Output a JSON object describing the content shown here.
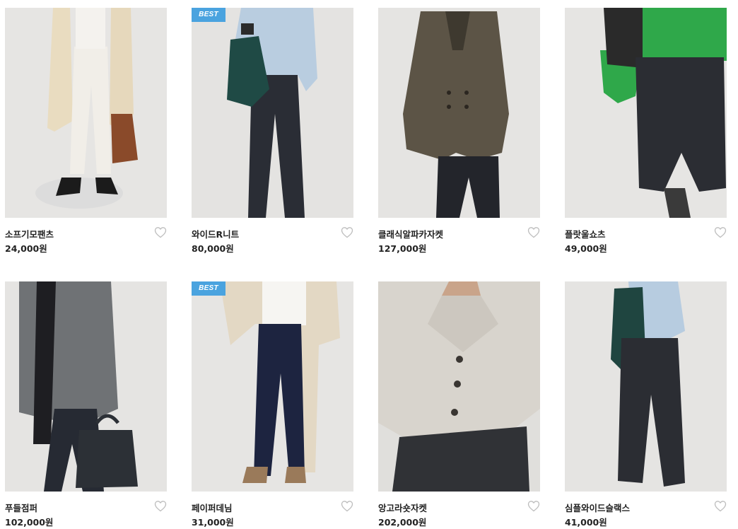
{
  "products": [
    {
      "name": "소프기모팬츠",
      "price": "24,000원",
      "badge": "",
      "image": "photo-beige-coat-white-pants-brown-bag"
    },
    {
      "name": "와이드R니트",
      "price": "80,000원",
      "badge": "BEST",
      "image": "photo-light-blue-knit-dark-scarf"
    },
    {
      "name": "클래식알파카자켓",
      "price": "127,000원",
      "badge": "",
      "image": "photo-brown-double-breasted-jacket"
    },
    {
      "name": "플랏울쇼츠",
      "price": "49,000원",
      "badge": "",
      "image": "photo-green-sweater-charcoal-shorts"
    },
    {
      "name": "푸들점퍼",
      "price": "102,000원",
      "badge": "",
      "image": "photo-gray-boucle-jumper-black-bag"
    },
    {
      "name": "페이퍼데님",
      "price": "31,000원",
      "badge": "BEST",
      "image": "photo-cream-coat-dark-denim"
    },
    {
      "name": "앙고라숏자켓",
      "price": "202,000원",
      "badge": "",
      "image": "photo-light-gray-angora-short-jacket"
    },
    {
      "name": "심플와이드슬랙스",
      "price": "41,000원",
      "badge": "",
      "image": "photo-charcoal-wide-slacks-blue-knit"
    }
  ],
  "icons": {
    "wishlist": "heart-outline-icon"
  },
  "colors": {
    "badge": "#4aa3df",
    "text": "#222222",
    "heart": "#bdbdbd"
  }
}
